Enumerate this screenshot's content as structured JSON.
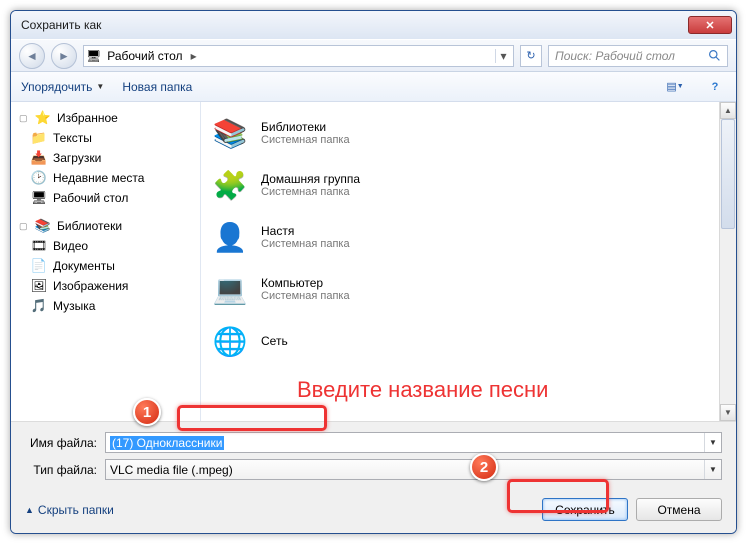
{
  "window": {
    "title": "Сохранить как"
  },
  "nav": {
    "location": "Рабочий стол",
    "search_placeholder": "Поиск: Рабочий стол"
  },
  "toolbar": {
    "organize": "Упорядочить",
    "new_folder": "Новая папка"
  },
  "tree": {
    "favorites": {
      "label": "Избранное",
      "items": [
        {
          "icon": "📁",
          "label": "Тексты"
        },
        {
          "icon": "📥",
          "label": "Загрузки"
        },
        {
          "icon": "🕑",
          "label": "Недавние места"
        },
        {
          "icon": "🖥",
          "label": "Рабочий стол"
        }
      ]
    },
    "libraries": {
      "label": "Библиотеки",
      "items": [
        {
          "icon": "🎞",
          "label": "Видео"
        },
        {
          "icon": "📄",
          "label": "Документы"
        },
        {
          "icon": "🖼",
          "label": "Изображения"
        },
        {
          "icon": "🎵",
          "label": "Музыка"
        }
      ]
    }
  },
  "content": {
    "subtitle": "Системная папка",
    "items": [
      {
        "icon": "📚",
        "title": "Библиотеки"
      },
      {
        "icon": "🧩",
        "title": "Домашняя группа"
      },
      {
        "icon": "👤",
        "title": "Настя"
      },
      {
        "icon": "💻",
        "title": "Компьютер"
      },
      {
        "icon": "🌐",
        "title": "Сеть"
      }
    ]
  },
  "form": {
    "filename_label": "Имя файла:",
    "filename_value": "(17) Одноклассники",
    "filetype_label": "Тип файла:",
    "filetype_value": "VLC media file (.mpeg)"
  },
  "footer": {
    "hide_folders": "Скрыть папки",
    "save": "Сохранить",
    "cancel": "Отмена"
  },
  "annotation": {
    "badge1": "1",
    "badge2": "2",
    "text": "Введите название песни"
  }
}
